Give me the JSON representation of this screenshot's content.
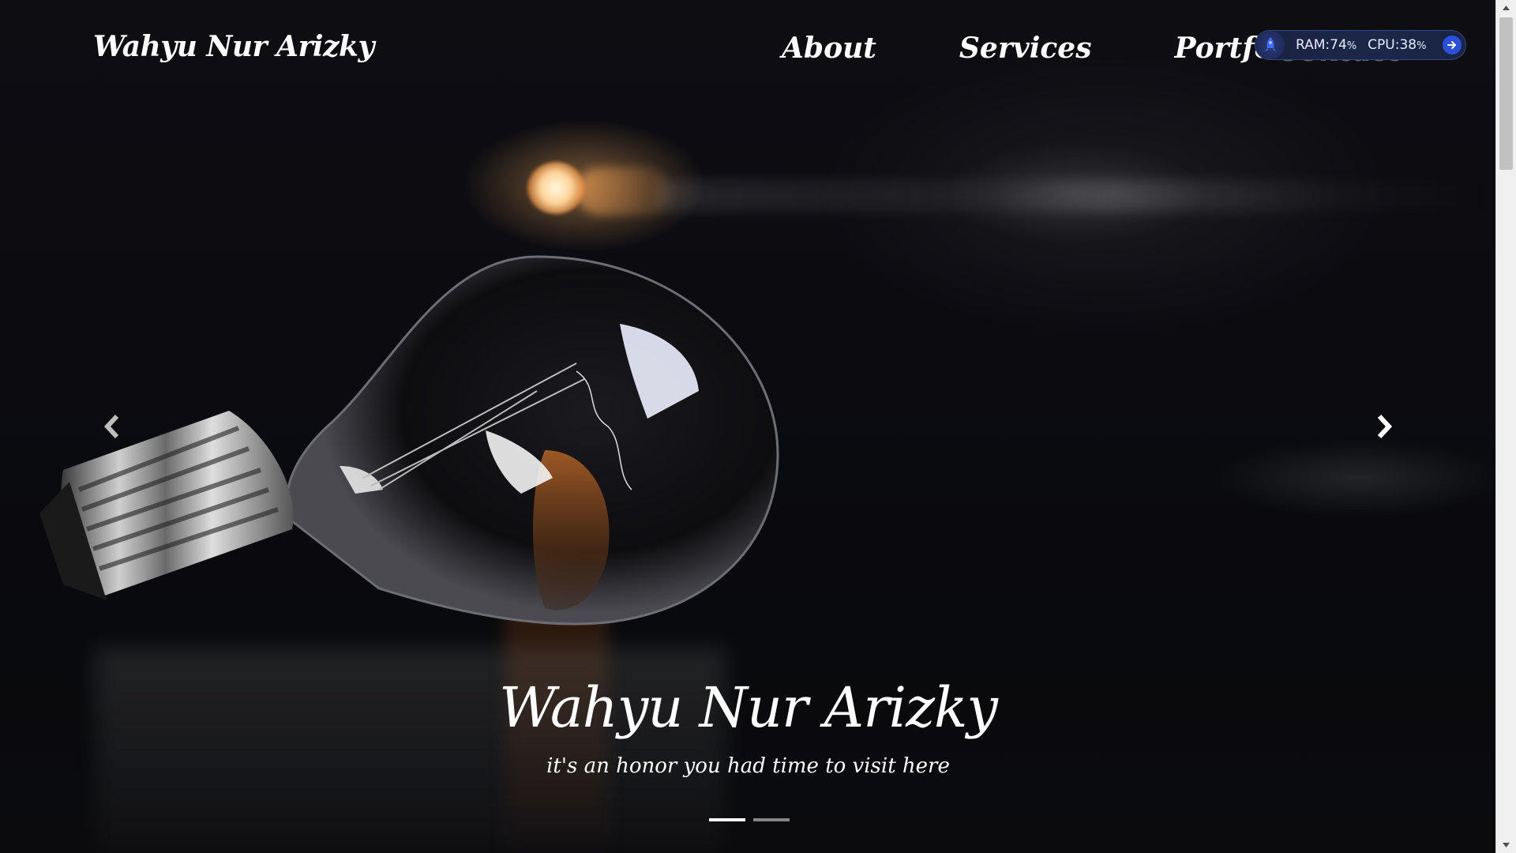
{
  "navbar": {
    "brand": "Wahyu Nur Arizky",
    "links": [
      {
        "label": "About"
      },
      {
        "label": "Services"
      },
      {
        "label": "Portfolio"
      }
    ],
    "hidden_link": "Contact"
  },
  "system_monitor": {
    "ram_label": "RAM:",
    "ram_value": "74",
    "cpu_label": "CPU:",
    "cpu_value": "38",
    "percent": "%",
    "icons": [
      "rocket-icon",
      "arrow-right-icon"
    ],
    "accent": "#2b4fd8"
  },
  "carousel": {
    "title": "Wahyu Nur Arizky",
    "subtitle": "it's an honor you had time to visit here",
    "indicators": [
      true,
      false
    ],
    "controls": [
      "chevron-left-icon",
      "chevron-right-icon"
    ]
  },
  "colors": {
    "background": "#0b0b0f",
    "text": "#ffffff",
    "bulb_glow": "#ffb060"
  }
}
